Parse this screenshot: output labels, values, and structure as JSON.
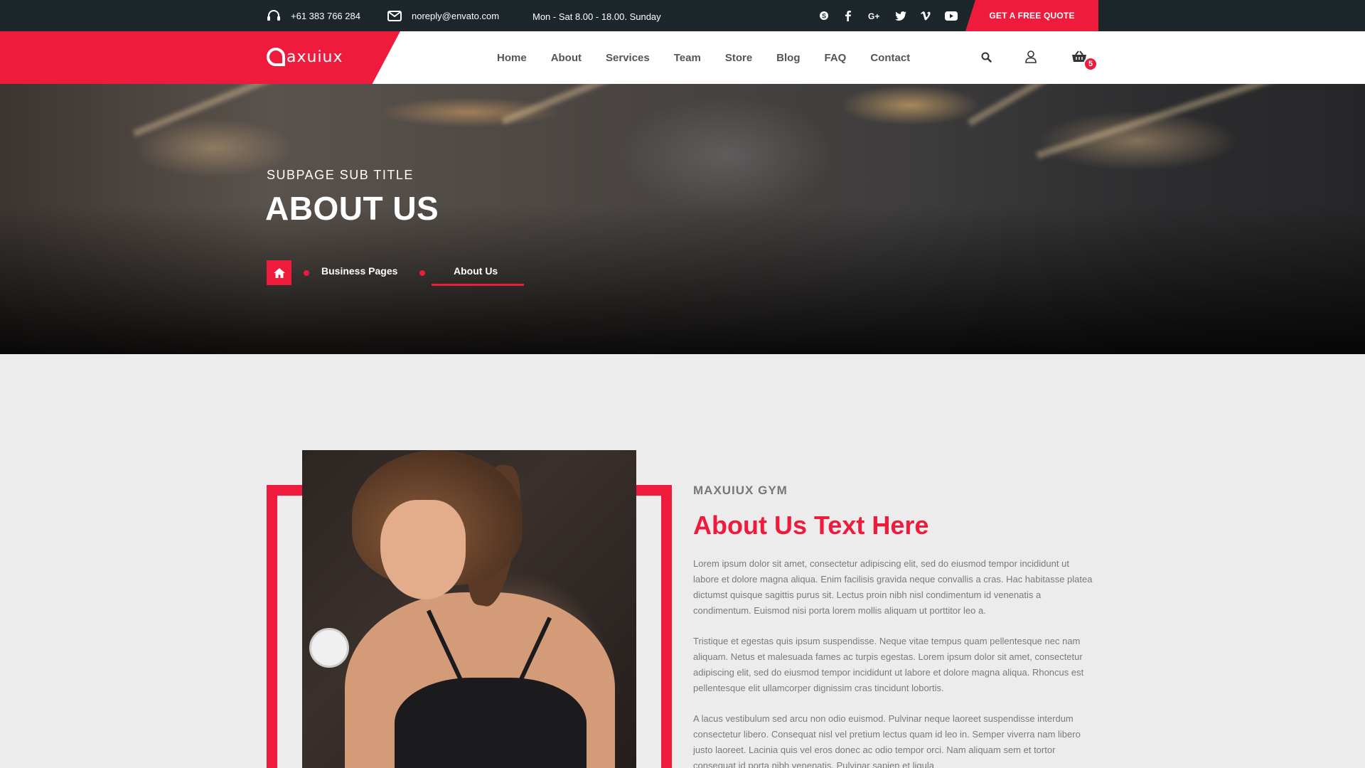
{
  "topbar": {
    "phone": "+61 383 766 284",
    "email": "noreply@envato.com",
    "hours": "Mon - Sat 8.00 - 18.00. Sunday",
    "socials": [
      "skype-icon",
      "facebook-icon",
      "google-plus-icon",
      "twitter-icon",
      "vimeo-icon",
      "youtube-icon"
    ],
    "quote_button": "GET A FREE QUOTE"
  },
  "brand": {
    "logo_text": "axuiux",
    "accent": "#ee1b3d"
  },
  "nav": {
    "items": [
      "Home",
      "About",
      "Services",
      "Team",
      "Store",
      "Blog",
      "FAQ",
      "Contact"
    ],
    "cart_count": "5"
  },
  "hero": {
    "subtitle": "SUBPAGE SUB TITLE",
    "title": "ABOUT US",
    "breadcrumb": [
      "Business Pages",
      "About Us"
    ]
  },
  "about": {
    "kicker": "MAXUIUX GYM",
    "title": "About Us Text Here",
    "paragraphs": [
      "Lorem ipsum dolor sit amet, consectetur adipiscing elit, sed do eiusmod tempor incididunt ut labore et dolore magna aliqua. Enim facilisis gravida neque convallis a cras. Hac habitasse platea dictumst quisque sagittis purus sit. Lectus proin nibh nisl condimentum id venenatis a condimentum. Euismod nisi porta lorem mollis aliquam ut porttitor leo a.",
      "Tristique et egestas quis ipsum suspendisse. Neque vitae tempus quam pellentesque nec nam aliquam. Netus et malesuada fames ac turpis egestas. Lorem ipsum dolor sit amet, consectetur adipiscing elit, sed do eiusmod tempor incididunt ut labore et dolore magna aliqua. Rhoncus est pellentesque elit ullamcorper dignissim cras tincidunt lobortis.",
      "A lacus vestibulum sed arcu non odio euismod. Pulvinar neque laoreet suspendisse interdum consectetur libero. Consequat nisl vel pretium lectus quam id leo in. Semper viverra nam libero justo laoreet. Lacinia quis vel eros donec ac odio tempor orci. Nam aliquam sem et tortor consequat id porta nibh venenatis. Pulvinar sapien et ligula"
    ]
  }
}
